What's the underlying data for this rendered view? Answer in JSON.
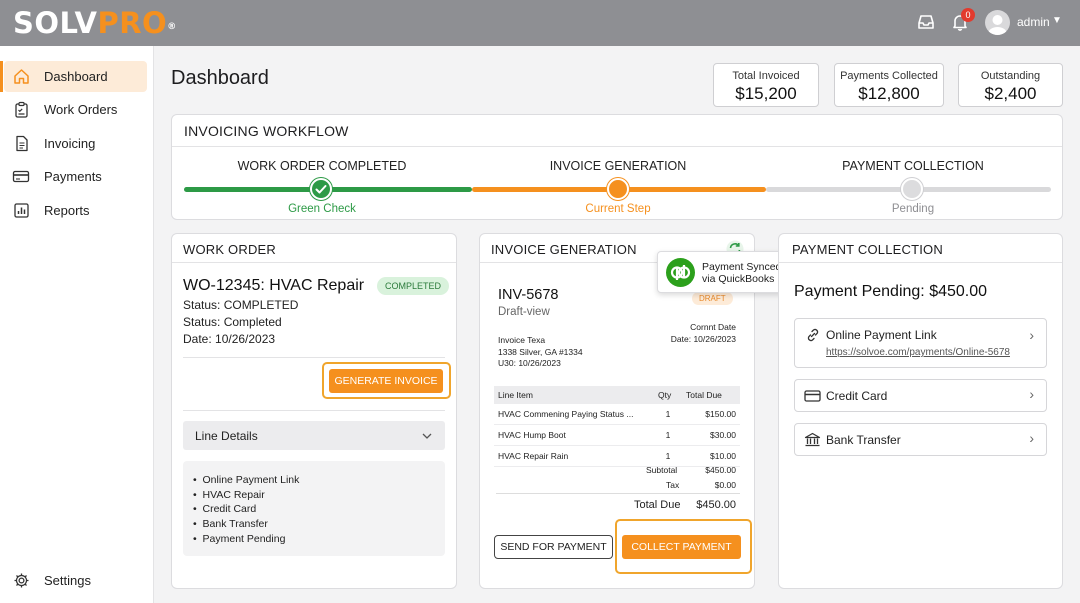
{
  "brand": {
    "logo_a": "SOLV",
    "logo_b": "PRO",
    "logo_reg": "®"
  },
  "topbar": {
    "notification_count": "0",
    "user_name": "admin"
  },
  "sidebar": {
    "items": [
      {
        "label": "Dashboard",
        "icon": "home-icon"
      },
      {
        "label": "Work Orders",
        "icon": "clipboard-icon"
      },
      {
        "label": "Invoicing",
        "icon": "document-icon"
      },
      {
        "label": "Payments",
        "icon": "card-icon"
      },
      {
        "label": "Reports",
        "icon": "chart-icon"
      }
    ],
    "settings_label": "Settings"
  },
  "header": {
    "title": "Dashboard"
  },
  "stats": [
    {
      "label": "Total Invoiced",
      "value": "$15,200"
    },
    {
      "label": "Payments Collected",
      "value": "$12,800"
    },
    {
      "label": "Outstanding",
      "value": "$2,400"
    }
  ],
  "workflow": {
    "title": "INVOICING WORKFLOW",
    "steps": [
      {
        "label": "WORK ORDER COMPLETED",
        "sub": "Green Check",
        "color": "#2d9a46"
      },
      {
        "label": "INVOICE GENERATION",
        "sub": "Current Step",
        "color": "#f5901e"
      },
      {
        "label": "PAYMENT COLLECTION",
        "sub": "Pending",
        "color": "#8e8e92"
      }
    ]
  },
  "work_order": {
    "title": "WORK ORDER",
    "name": "WO-12345: HVAC Repair",
    "badge": "COMPLETED",
    "status_1": "Status: COMPLETED",
    "status_2": "Status: Completed",
    "date": "Date: 10/26/2023",
    "generate_label": "GENERATE INVOICE",
    "line_details_label": "Line Details",
    "list": [
      "Online Payment Link",
      "HVAC Repair",
      "Credit Card",
      "Bank Transfer",
      "Payment Pending"
    ]
  },
  "invoice": {
    "title": "INVOICE GENERATION",
    "sync_line1": "Payment Synced",
    "sync_line2": "via QuickBooks",
    "number": "INV-5678",
    "view": "Draft-view",
    "draft_badge": "DRAFT",
    "from_1": "Invoice Texa",
    "from_2": "1338 Silver, GA #1334",
    "from_3": "U30: 10/26/2023",
    "date_label": "Cornnt Date",
    "date_value": "Date: 10/26/2023",
    "headers": {
      "item": "Line Item",
      "qty": "Qty",
      "total": "Total Due"
    },
    "rows": [
      {
        "item": "HVAC Commening Paying Status ...",
        "qty": "1",
        "total": "$150.00"
      },
      {
        "item": "HVAC Hump Boot",
        "qty": "1",
        "total": "$30.00"
      },
      {
        "item": "HVAC Repair Rain",
        "qty": "1",
        "total": "$10.00"
      }
    ],
    "subtotal_label": "Subtotal",
    "subtotal": "$450.00",
    "tax_label": "Tax",
    "tax": "$0.00",
    "total_label": "Total Due",
    "total": "$450.00",
    "send_label": "SEND FOR PAYMENT",
    "collect_label": "COLLECT PAYMENT"
  },
  "payment": {
    "title": "PAYMENT COLLECTION",
    "pending": "Payment Pending: $450.00",
    "online_label": "Online Payment Link",
    "online_url": "https://solvoe.com/payments/Online-5678",
    "card_label": "Credit Card",
    "bank_label": "Bank Transfer"
  },
  "colors": {
    "accent": "#f5901e",
    "success": "#2d9a46",
    "topbar": "#8e8f93"
  }
}
